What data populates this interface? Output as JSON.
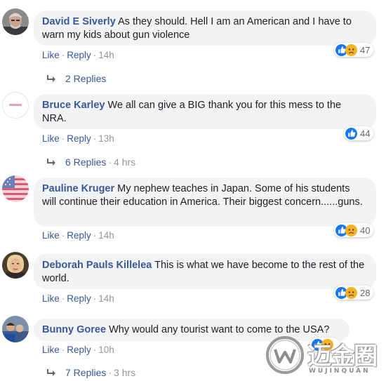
{
  "comments": [
    {
      "author": "David E Siverly",
      "text": "As they should. Hell I am an American and I have to warn my kids about gun violence",
      "like_label": "Like",
      "reply_label": "Reply",
      "time": "14h",
      "reaction_count": "47",
      "reactions": [
        "like-icon",
        "sad-icon"
      ],
      "replies_label": "2 Replies",
      "replies_ago": ""
    },
    {
      "author": "Bruce Karley",
      "text": "We all can give a BIG thank you for this mess to the NRA.",
      "like_label": "Like",
      "reply_label": "Reply",
      "time": "13h",
      "reaction_count": "44",
      "reactions": [
        "like-icon"
      ],
      "replies_label": "6 Replies",
      "replies_ago": "4 hrs"
    },
    {
      "author": "Pauline Kruger",
      "text": "My nephew teaches in Japan. Some of his students will continue their education in America. Their biggest concern......guns.",
      "like_label": "Like",
      "reply_label": "Reply",
      "time": "14h",
      "reaction_count": "40",
      "reactions": [
        "like-icon",
        "sad-icon"
      ],
      "replies_label": "",
      "replies_ago": ""
    },
    {
      "author": "Deborah Pauls Killelea",
      "text": "This is what we have become to the rest of the world.",
      "like_label": "Like",
      "reply_label": "Reply",
      "time": "14h",
      "reaction_count": "28",
      "reactions": [
        "like-icon",
        "sad-icon"
      ],
      "replies_label": "",
      "replies_ago": ""
    },
    {
      "author": "Bunny Goree",
      "text": "Why would any tourist want to come to the USA?",
      "like_label": "Like",
      "reply_label": "Reply",
      "time": "10h",
      "reaction_count": "",
      "reactions": [
        "like-icon",
        "sad-icon"
      ],
      "replies_label": "7 Replies",
      "replies_ago": "3 hrs"
    }
  ],
  "separator": "·",
  "watermark": {
    "text": "迈金圈",
    "subtext": "WUJINQUAN"
  },
  "colors": {
    "author": "#385898",
    "bubble": "#f2f3f5",
    "meta": "#90949c",
    "like": "#1877f2",
    "sad": "#f7b125"
  }
}
